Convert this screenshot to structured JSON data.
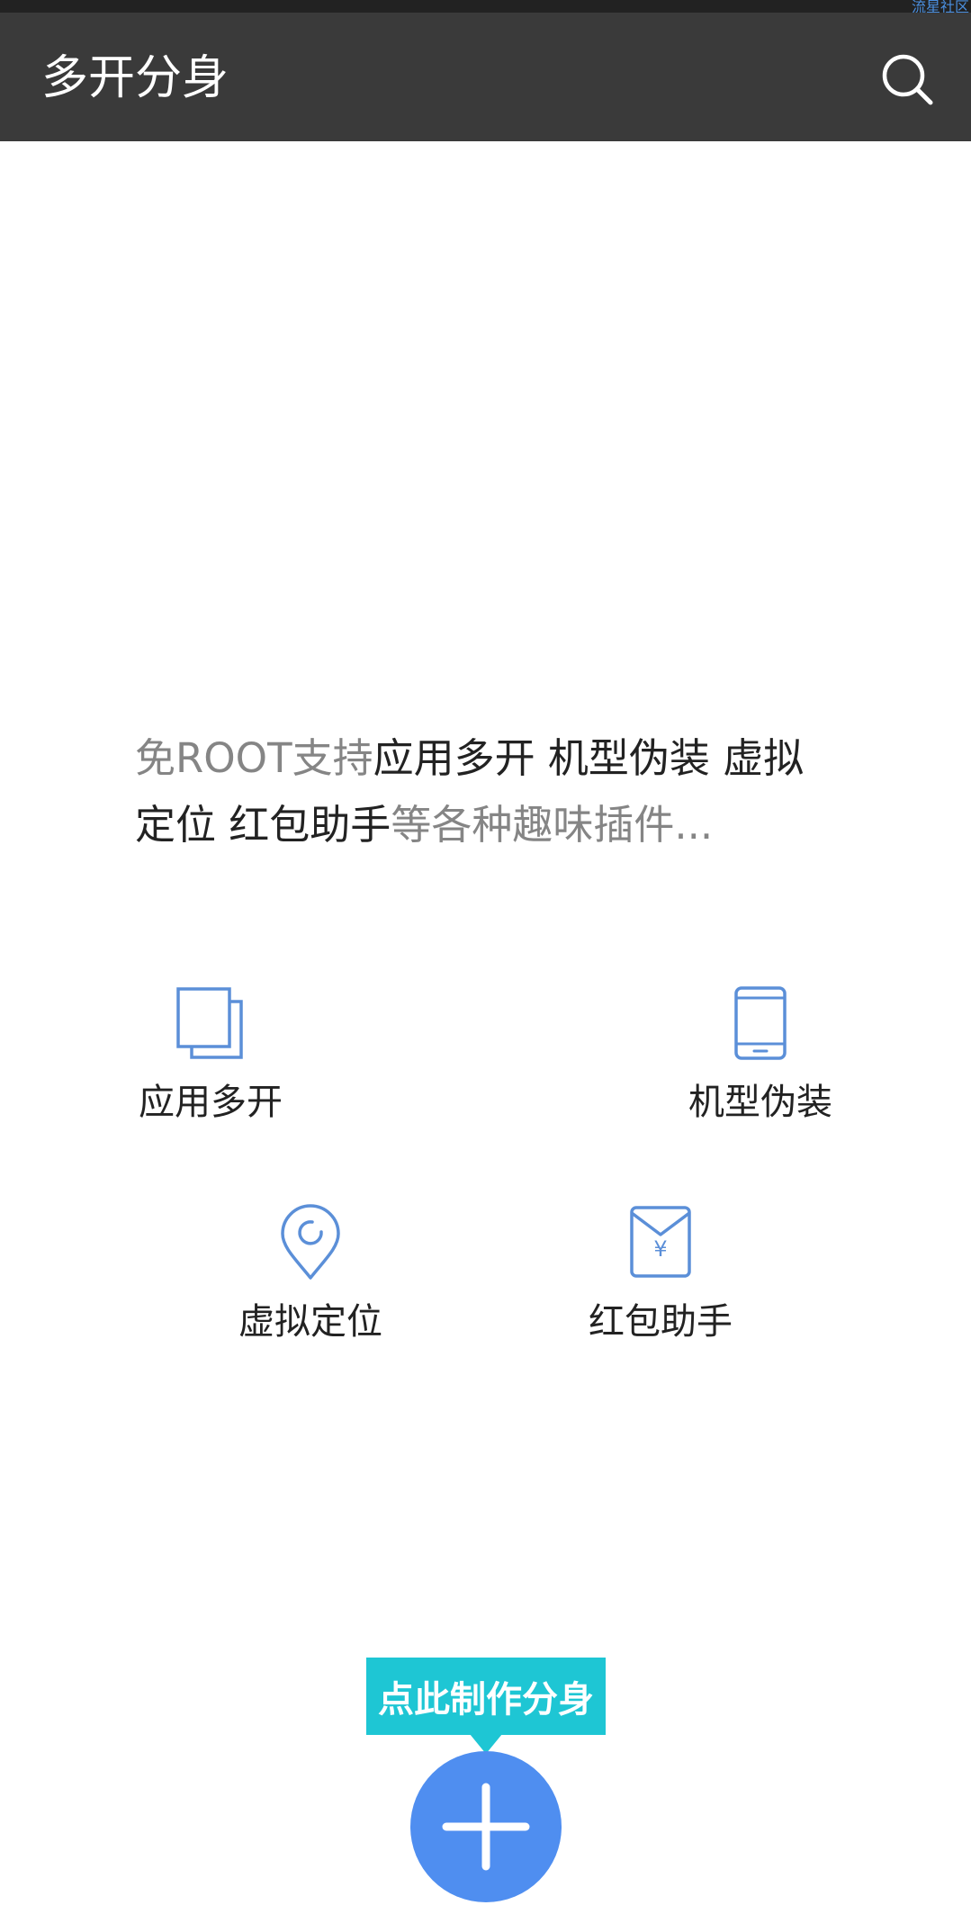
{
  "watermark": "流星社区",
  "app_bar": {
    "title": "多开分身"
  },
  "intro": {
    "part1": "免ROOT支持",
    "part2": "应用多开 机型伪装 虚拟定位 红包助手",
    "part3": "等各种趣味插件..."
  },
  "features": {
    "multi_open": "应用多开",
    "device_spoof": "机型伪装",
    "virtual_location": "虚拟定位",
    "red_packet": "红包助手"
  },
  "icons": {
    "multi_open": "copy-icon",
    "device_spoof": "phone-icon",
    "virtual_location": "location-pin-icon",
    "red_packet": "red-packet-icon",
    "search": "search-icon",
    "plus": "plus-icon",
    "yen_symbol": "¥"
  },
  "cta": {
    "tooltip": "点此制作分身"
  },
  "colors": {
    "app_bar": "#3a3a3a",
    "icon_blue": "#5b8fd8",
    "tooltip": "#1ec6d4",
    "fab": "#4f8ef0",
    "muted_text": "#858585"
  }
}
